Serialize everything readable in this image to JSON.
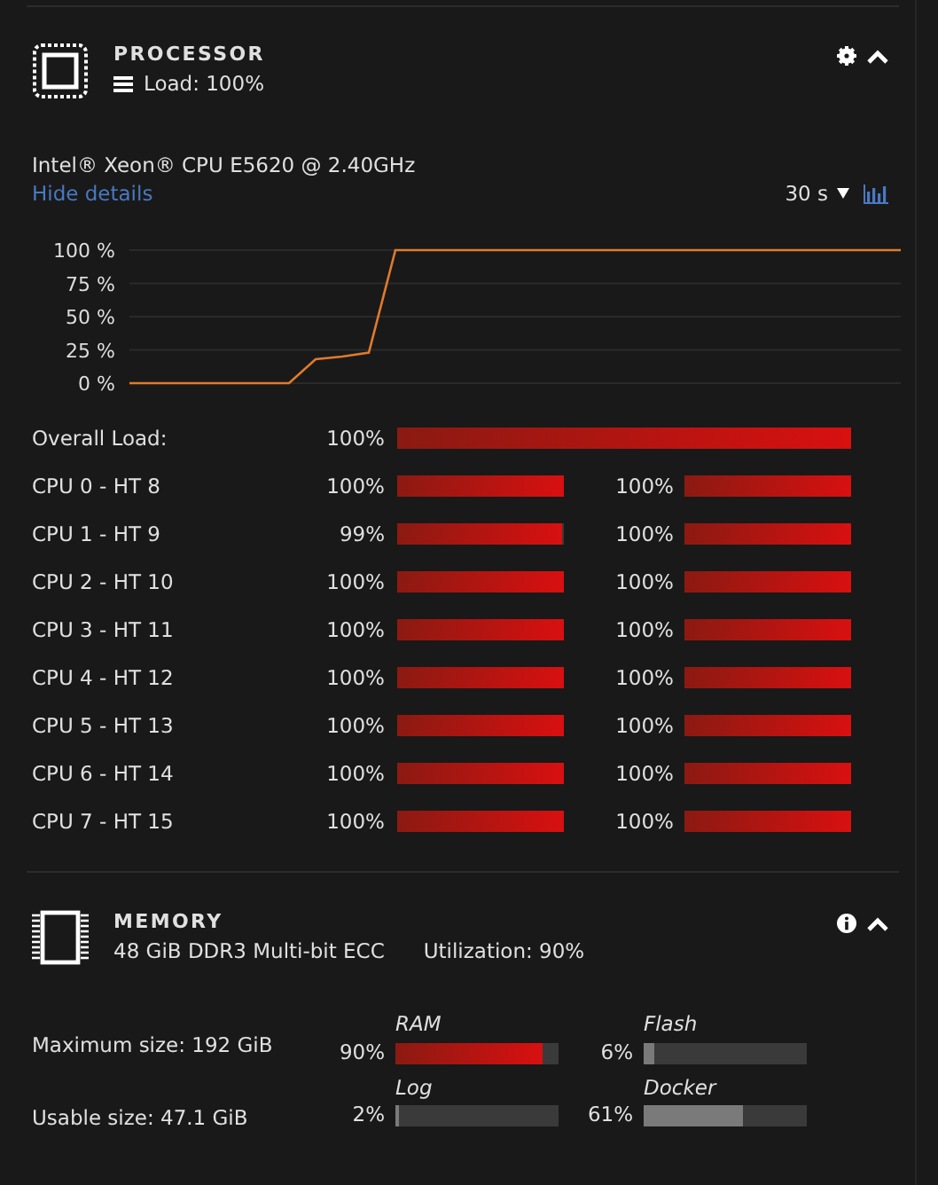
{
  "processor": {
    "title": "PROCESSOR",
    "load": "Load: 100%",
    "model": "Intel® Xeon® CPU E5620 @ 2.40GHz",
    "details_link": "Hide details",
    "interval": "30 s",
    "chart_data": {
      "type": "line",
      "grid": true,
      "ylim": [
        0,
        100
      ],
      "yticks": [
        {
          "value": 0,
          "label": "0 %"
        },
        {
          "value": 25,
          "label": "25 %"
        },
        {
          "value": 50,
          "label": "50 %"
        },
        {
          "value": 75,
          "label": "75 %"
        },
        {
          "value": 100,
          "label": "100 %"
        }
      ],
      "series": [
        {
          "color": "#e07b2c",
          "values": [
            0,
            0,
            0,
            0,
            0,
            0,
            0,
            18,
            20,
            23,
            100,
            100,
            100,
            100,
            100,
            100,
            100,
            100,
            100,
            100,
            100,
            100,
            100,
            100,
            100,
            100,
            100,
            100,
            100,
            100
          ]
        }
      ]
    },
    "overall": {
      "label": "Overall Load:",
      "reading": "100%",
      "level": 1
    },
    "cpus": [
      {
        "name": "CPU 0 - HT 8",
        "threads": [
          {
            "reading": "100%",
            "level": 1
          },
          {
            "reading": "100%",
            "level": 1
          }
        ]
      },
      {
        "name": "CPU 1 - HT 9",
        "threads": [
          {
            "reading": "99%",
            "level": 0.99
          },
          {
            "reading": "100%",
            "level": 1
          }
        ]
      },
      {
        "name": "CPU 2 - HT 10",
        "threads": [
          {
            "reading": "100%",
            "level": 1
          },
          {
            "reading": "100%",
            "level": 1
          }
        ]
      },
      {
        "name": "CPU 3 - HT 11",
        "threads": [
          {
            "reading": "100%",
            "level": 1
          },
          {
            "reading": "100%",
            "level": 1
          }
        ]
      },
      {
        "name": "CPU 4 - HT 12",
        "threads": [
          {
            "reading": "100%",
            "level": 1
          },
          {
            "reading": "100%",
            "level": 1
          }
        ]
      },
      {
        "name": "CPU 5 - HT 13",
        "threads": [
          {
            "reading": "100%",
            "level": 1
          },
          {
            "reading": "100%",
            "level": 1
          }
        ]
      },
      {
        "name": "CPU 6 - HT 14",
        "threads": [
          {
            "reading": "100%",
            "level": 1
          },
          {
            "reading": "100%",
            "level": 1
          }
        ]
      },
      {
        "name": "CPU 7 - HT 15",
        "threads": [
          {
            "reading": "100%",
            "level": 1
          },
          {
            "reading": "100%",
            "level": 1
          }
        ]
      }
    ]
  },
  "memory": {
    "title": "MEMORY",
    "description": "48 GiB DDR3 Multi-bit ECC",
    "utilization": "Utilization: 90%",
    "sizes": [
      "Maximum size: 192 GiB",
      "Usable size: 47.1 GiB"
    ],
    "meters": [
      {
        "label": "RAM",
        "reading": "90%",
        "level": 0.9,
        "kind": "high"
      },
      {
        "label": "Flash",
        "reading": "6%",
        "level": 0.06,
        "kind": "normal"
      },
      {
        "label": "Log",
        "reading": "2%",
        "level": 0.02,
        "kind": "normal"
      },
      {
        "label": "Docker",
        "reading": "61%",
        "level": 0.61,
        "kind": "normal"
      }
    ]
  }
}
